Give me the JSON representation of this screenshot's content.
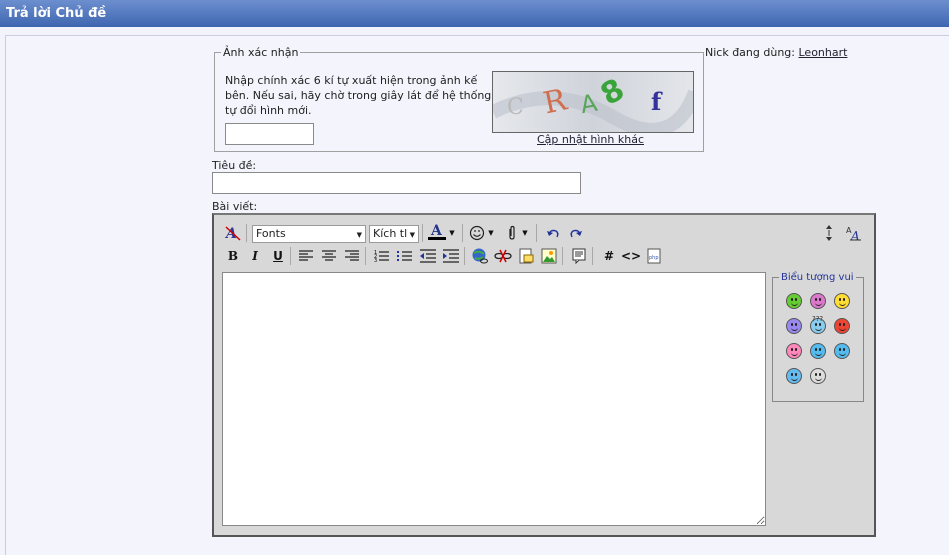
{
  "header": {
    "title": "Trả lời Chủ đề"
  },
  "captcha": {
    "legend": "Ảnh xác nhận",
    "instructions": "Nhập chính xác 6 kí tự xuất hiện trong ảnh kế bên. Nếu sai, hãy chờ trong giây lát để hệ thống tự đổi hình mới.",
    "input_value": "",
    "image_chars": [
      "C",
      "R",
      "A",
      "8",
      "f"
    ],
    "refresh_link": "Cập nhật hình khác"
  },
  "user": {
    "label": "Nick đang dùng:",
    "name": "Leonhart"
  },
  "form": {
    "title_label": "Tiêu đề:",
    "title_value": "",
    "body_label": "Bài viết:"
  },
  "toolbar": {
    "font_select": "Fonts",
    "size_select": "Kích tl",
    "icons": {
      "remove_format": "remove-format-icon",
      "font_color": "font-color-icon",
      "smiley_menu": "smiley-icon",
      "attach": "attachment-icon",
      "undo": "undo-icon",
      "redo": "redo-icon",
      "resize": "resize-icon",
      "switch_mode": "switch-mode-icon"
    },
    "font_color_value": "#000000"
  },
  "smilies": {
    "legend": "Biểu tượng vui",
    "items": [
      {
        "name": "grin",
        "color": "#66cc33"
      },
      {
        "name": "big-smile",
        "color": "#dd77cc"
      },
      {
        "name": "smile",
        "color": "#ffdd33"
      },
      {
        "name": "sad",
        "color": "#9988ee"
      },
      {
        "name": "confused",
        "color": "#88ccee"
      },
      {
        "name": "angry",
        "color": "#ee4433"
      },
      {
        "name": "tongue",
        "color": "#ff88bb"
      },
      {
        "name": "wink",
        "color": "#55bbee"
      },
      {
        "name": "laugh",
        "color": "#55bbee"
      },
      {
        "name": "cool",
        "color": "#66bbee"
      },
      {
        "name": "shocked",
        "color": "#dddddd"
      }
    ],
    "question_mark_text": "???"
  }
}
